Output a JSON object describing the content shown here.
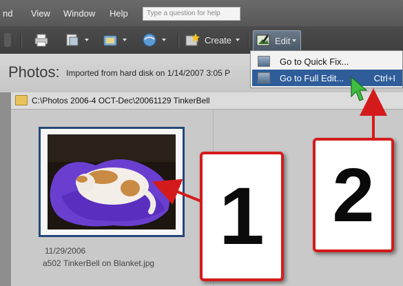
{
  "menubar": {
    "items": [
      "nd",
      "View",
      "Window",
      "Help"
    ],
    "help_placeholder": "Type a question for help"
  },
  "toolbar": {
    "create_label": "Create",
    "edit_label": "Edit"
  },
  "photos_bar": {
    "title": "Photos:",
    "subtitle": "Imported from hard disk on 1/14/2007 3:05 P"
  },
  "content": {
    "folder_path": "C:\\Photos 2006-4 OCT-Dec\\20061129 TinkerBell",
    "thumbnail": {
      "date": "11/29/2006",
      "filename": "a502 TinkerBell on Blanket.jpg"
    }
  },
  "edit_menu": {
    "items": [
      {
        "label": "Go to Quick Fix...",
        "shortcut": ""
      },
      {
        "label": "Go to Full Edit...",
        "shortcut": "Ctrl+I"
      }
    ]
  },
  "callouts": [
    "1",
    "2"
  ],
  "colors": {
    "callout_border": "#d41b1b",
    "menu_highlight": "#2f5d9a",
    "thumb_border": "#24467a",
    "cursor": "#3fbf3f"
  }
}
